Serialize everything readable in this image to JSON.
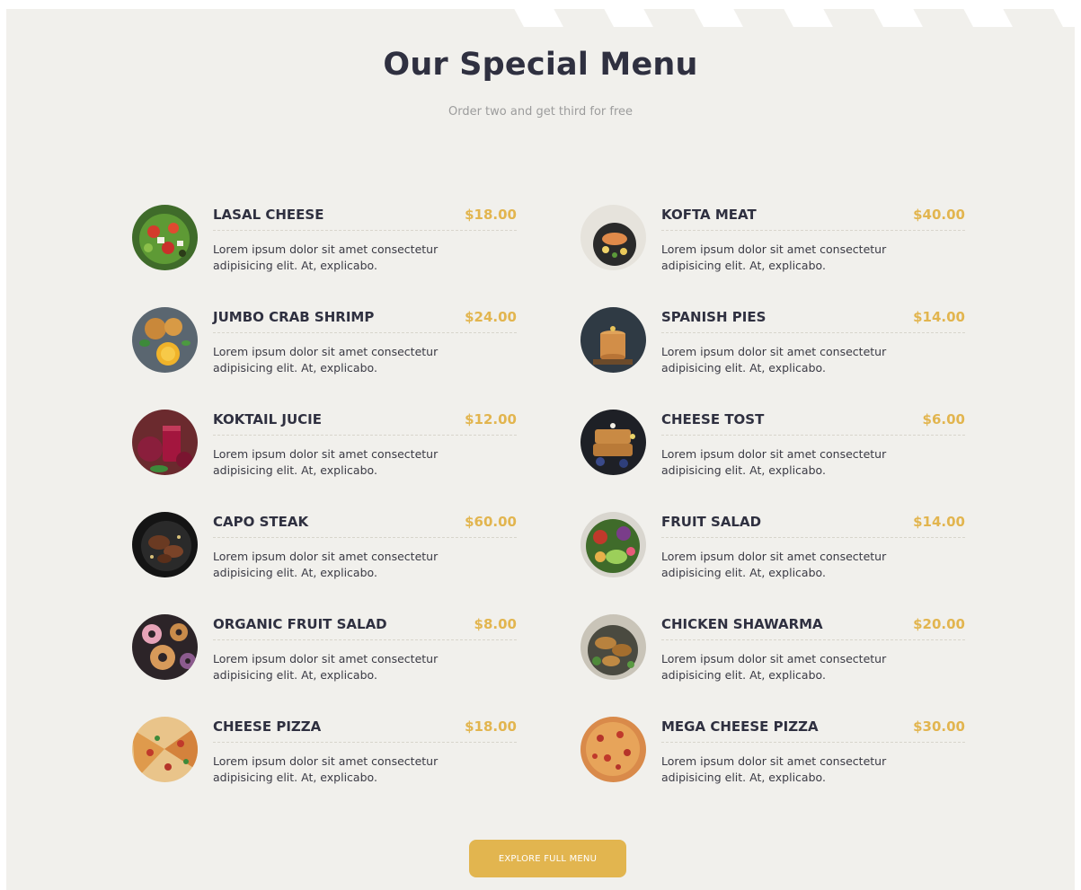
{
  "header": {
    "title": "Our Special Menu",
    "subtitle": "Order two and get third for free"
  },
  "menu": {
    "left": [
      {
        "name": "LASAL CHEESE",
        "price": "$18.00",
        "description": "Lorem ipsum dolor sit amet consectetur adipisicing elit. At, explicabo.",
        "image": "salad-bowl"
      },
      {
        "name": "JUMBO CRAB SHRIMP",
        "price": "$24.00",
        "description": "Lorem ipsum dolor sit amet consectetur adipisicing elit. At, explicabo.",
        "image": "shrimp-dish"
      },
      {
        "name": "KOKTAIL JUCIE",
        "price": "$12.00",
        "description": "Lorem ipsum dolor sit amet consectetur adipisicing elit. At, explicabo.",
        "image": "beet-juice"
      },
      {
        "name": "CAPO STEAK",
        "price": "$60.00",
        "description": "Lorem ipsum dolor sit amet consectetur adipisicing elit. At, explicabo.",
        "image": "steak-pan"
      },
      {
        "name": "ORGANIC FRUIT SALAD",
        "price": "$8.00",
        "description": "Lorem ipsum dolor sit amet consectetur adipisicing elit. At, explicabo.",
        "image": "donuts"
      },
      {
        "name": "CHEESE PIZZA",
        "price": "$18.00",
        "description": "Lorem ipsum dolor sit amet consectetur adipisicing elit. At, explicabo.",
        "image": "pizza"
      }
    ],
    "right": [
      {
        "name": "KOFTA MEAT",
        "price": "$40.00",
        "description": "Lorem ipsum dolor sit amet consectetur adipisicing elit. At, explicabo.",
        "image": "salmon-plate"
      },
      {
        "name": "SPANISH PIES",
        "price": "$14.00",
        "description": "Lorem ipsum dolor sit amet consectetur adipisicing elit. At, explicabo.",
        "image": "pancake-stack"
      },
      {
        "name": "CHEESE TOST",
        "price": "$6.00",
        "description": "Lorem ipsum dolor sit amet consectetur adipisicing elit. At, explicabo.",
        "image": "french-toast"
      },
      {
        "name": "FRUIT SALAD",
        "price": "$14.00",
        "description": "Lorem ipsum dolor sit amet consectetur adipisicing elit. At, explicabo.",
        "image": "veggie-bowl"
      },
      {
        "name": "CHICKEN SHAWARMA",
        "price": "$20.00",
        "description": "Lorem ipsum dolor sit amet consectetur adipisicing elit. At, explicabo.",
        "image": "grilled-chicken"
      },
      {
        "name": "MEGA CHEESE PIZZA",
        "price": "$30.00",
        "description": "Lorem ipsum dolor sit amet consectetur adipisicing elit. At, explicabo.",
        "image": "pizza-top"
      }
    ]
  },
  "cta": {
    "label": "EXPLORE FULL MENU"
  },
  "colors": {
    "accent": "#e2b54f",
    "heading": "#2f3040",
    "background": "#f1f0ec"
  }
}
